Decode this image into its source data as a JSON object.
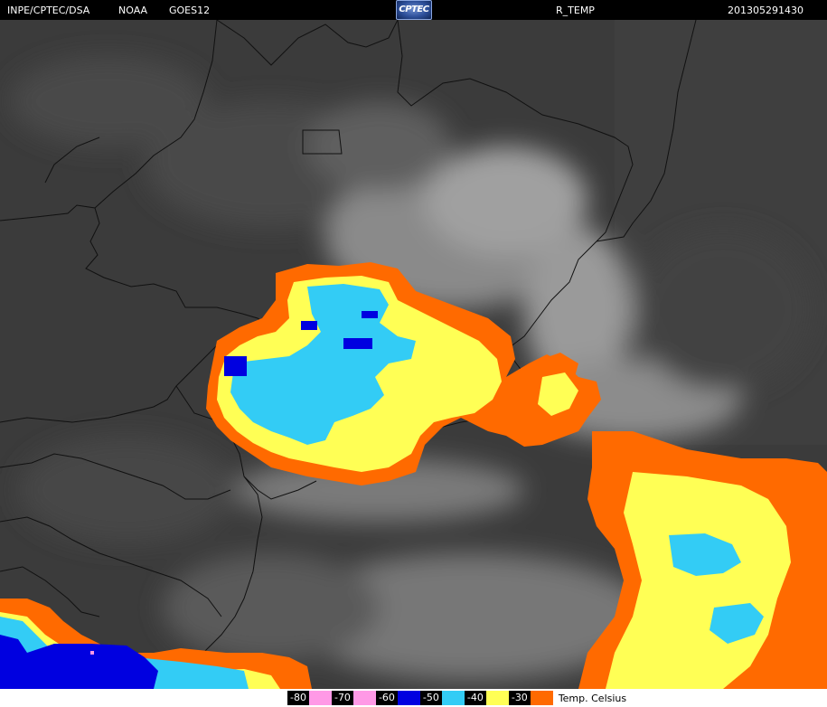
{
  "header": {
    "source": "INPE/CPTEC/DSA",
    "agency": "NOAA",
    "satellite": "GOES12",
    "logo": "CPTEC",
    "product": "R_TEMP",
    "timestamp": "201305291430"
  },
  "legend": {
    "items": [
      {
        "label": "-80",
        "color": "#ff99e6"
      },
      {
        "label": "-70",
        "color": "#ff99e6"
      },
      {
        "label": "-60",
        "color": "#0000e0"
      },
      {
        "label": "-50",
        "color": "#33ccf5"
      },
      {
        "label": "-40",
        "color": "#ffff55"
      },
      {
        "label": "-30",
        "color": "#ff6a00"
      }
    ],
    "unit": "Temp. Celsius"
  },
  "colors": {
    "background": "#3a3a3a",
    "borders": "#000000"
  }
}
